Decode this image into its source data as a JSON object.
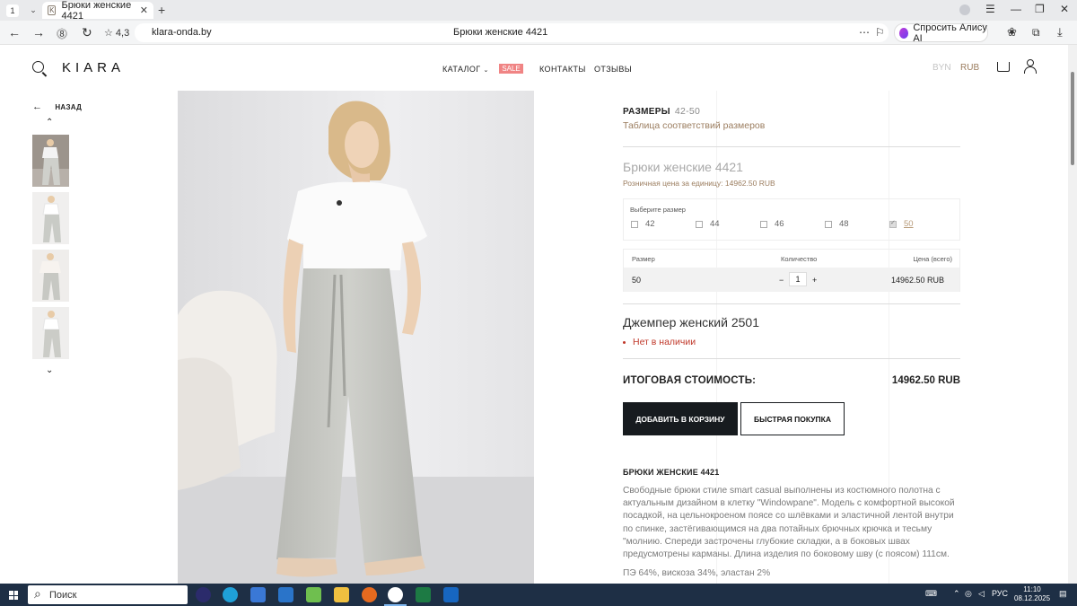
{
  "browser": {
    "tab_count": "1",
    "tab_title": "Брюки женские 4421",
    "tab_favicon": "K",
    "rating": "4,3",
    "url": "klara-onda.by",
    "page_title": "Брюки женские 4421",
    "alice_label": "Спросить Алису AI"
  },
  "header": {
    "logo": "KIARA",
    "nav": {
      "catalog": "КАТАЛОГ",
      "sale": "SALE",
      "contacts": "КОНТАКТЫ",
      "reviews": "ОТЗЫВЫ"
    },
    "currency_byn": "BYN",
    "currency_rub": "RUB",
    "colors": {
      "sale": "#f08484",
      "active_currency": "#9b7d5f",
      "inactive_currency": "#c5c5c5"
    }
  },
  "gallery": {
    "back_label": "НАЗАД",
    "thumbnail_count": 4
  },
  "product": {
    "sizes_label": "РАЗМЕРЫ",
    "sizes_value": "42-50",
    "size_table_link": "Таблица соответствий размеров",
    "title": "Брюки женские 4421",
    "retail_price": "Розничная цена за единицу: 14962.50 RUB",
    "choose_size_label": "Выберите размер",
    "sizes": [
      {
        "label": "42",
        "checked": false
      },
      {
        "label": "44",
        "checked": false
      },
      {
        "label": "46",
        "checked": false
      },
      {
        "label": "48",
        "checked": false
      },
      {
        "label": "50",
        "checked": true
      }
    ],
    "order_table": {
      "headers": [
        "Размер",
        "Количество",
        "Цена (всего)"
      ],
      "row": {
        "size": "50",
        "minus": "−",
        "quantity": "1",
        "plus": "+",
        "price": "14962.50 RUB"
      }
    },
    "related_title": "Джемпер женский 2501",
    "related_status": "Нет в наличии",
    "total_label": "ИТОГОВАЯ СТОИМОСТЬ:",
    "total_value": "14962.50 RUB",
    "add_to_cart": "ДОБАВИТЬ В КОРЗИНУ",
    "quick_buy": "БЫСТРАЯ ПОКУПКА",
    "description_title": "БРЮКИ ЖЕНСКИЕ 4421",
    "description": "Свободные брюки стиле smart casual выполнены из костюмного полотна с актуальным дизайном в клетку \"Windowpane\". Модель с комфортной высокой посадкой, на цельнокроеном поясе со шлёвками и эластичной лентой внутри по спинке, застёгивающимся на два потайных брючных крючка и тесьму \"молнию. Спереди застрочены глубокие складки, а в боковых швах предусмотрены карманы. Длина изделия по боковому шву (с поясом) 111см.",
    "composition": "ПЭ 64%, вискоза 34%, эластан 2%"
  },
  "taskbar": {
    "search_placeholder": "Поиск",
    "lang": "РУС",
    "time": "11:10",
    "date": "08.12.2025"
  }
}
